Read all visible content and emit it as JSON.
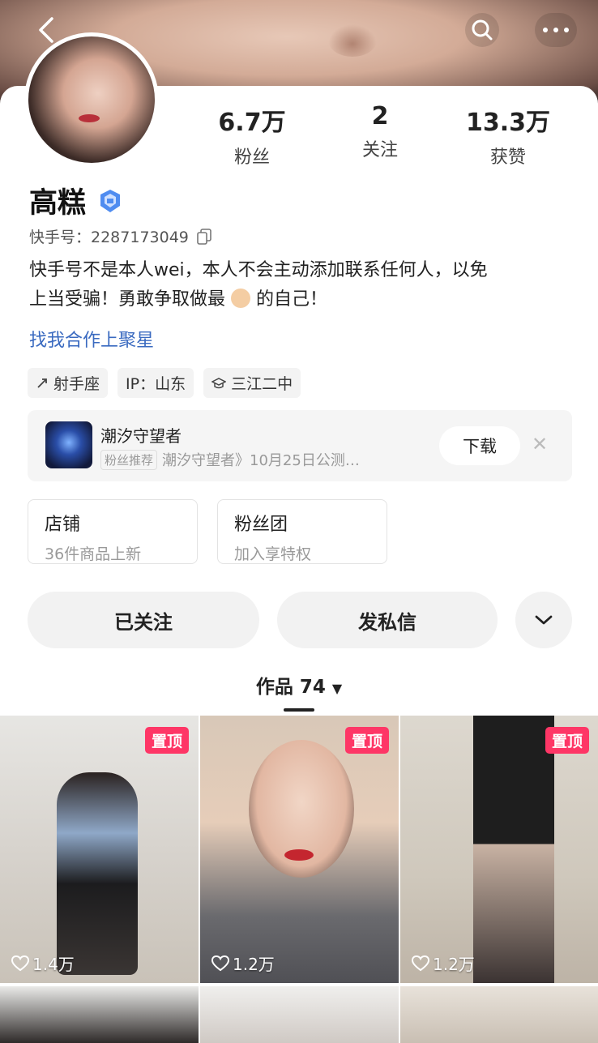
{
  "header": {
    "back_icon": "chevron-left-icon",
    "search_icon": "search-icon",
    "more_icon": "more-dots-icon"
  },
  "stats": [
    {
      "value": "6.7万",
      "label": "粉丝"
    },
    {
      "value": "2",
      "label": "关注"
    },
    {
      "value": "13.3万",
      "label": "获赞"
    }
  ],
  "profile": {
    "name": "高糕",
    "uid_label": "快手号：2287173049",
    "bio_line1": "快手号不是本人wei，本人不会主动添加联系任何人，以免",
    "bio_line2a": "上当受骗！勇敢争取做最",
    "bio_line2b": "的自己！",
    "link": "找我合作上聚星"
  },
  "tags": [
    "射手座",
    "IP：山东",
    "三江二中"
  ],
  "promo": {
    "title": "潮汐守望者",
    "badge": "粉丝推荐",
    "subtitle": "潮汐守望者》10月25日公测…",
    "download": "下载"
  },
  "boxes": [
    {
      "title": "店铺",
      "sub": "36件商品上新"
    },
    {
      "title": "粉丝团",
      "sub": "加入享特权"
    }
  ],
  "actions": {
    "follow": "已关注",
    "message": "发私信"
  },
  "works_tab": "作品 74",
  "videos": [
    {
      "pinned": "置顶",
      "likes": "1.4万"
    },
    {
      "pinned": "置顶",
      "likes": "1.2万"
    },
    {
      "pinned": "置顶",
      "likes": "1.2万"
    }
  ],
  "colors": {
    "accent": "#fe3666",
    "link": "#3a6ac0"
  }
}
